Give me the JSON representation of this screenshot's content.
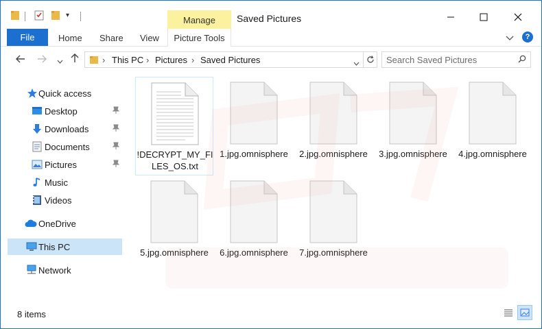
{
  "window": {
    "title": "Saved Pictures",
    "context_group": "Manage",
    "buttons": {
      "minimize": "minimize",
      "maximize": "maximize",
      "close": "close"
    }
  },
  "ribbon": {
    "tabs": [
      {
        "label": "File"
      },
      {
        "label": "Home"
      },
      {
        "label": "Share"
      },
      {
        "label": "View"
      },
      {
        "label": "Picture Tools"
      }
    ]
  },
  "address": {
    "crumbs": [
      "This PC",
      "Pictures",
      "Saved Pictures"
    ]
  },
  "search": {
    "placeholder": "Search Saved Pictures"
  },
  "sidebar": {
    "items": [
      {
        "label": "Quick access",
        "icon": "star-icon"
      },
      {
        "label": "Desktop",
        "icon": "desktop-folder-icon",
        "pinned": true
      },
      {
        "label": "Downloads",
        "icon": "download-arrow-icon",
        "pinned": true
      },
      {
        "label": "Documents",
        "icon": "documents-icon",
        "pinned": true
      },
      {
        "label": "Pictures",
        "icon": "pictures-icon",
        "pinned": true
      },
      {
        "label": "Music",
        "icon": "music-note-icon"
      },
      {
        "label": "Videos",
        "icon": "videos-icon"
      },
      {
        "label": "OneDrive",
        "icon": "cloud-icon"
      },
      {
        "label": "This PC",
        "icon": "computer-icon",
        "selected": true
      },
      {
        "label": "Network",
        "icon": "network-icon"
      }
    ]
  },
  "files": [
    {
      "name_line1": "!DECRYPT_MY_FI",
      "name_line2": "LES_OS.txt",
      "type": "text",
      "selected": true
    },
    {
      "name_line1": "1.jpg.omnisphere",
      "name_line2": "",
      "type": "blank"
    },
    {
      "name_line1": "2.jpg.omnisphere",
      "name_line2": "",
      "type": "blank"
    },
    {
      "name_line1": "3.jpg.omnisphere",
      "name_line2": "",
      "type": "blank"
    },
    {
      "name_line1": "4.jpg.omnisphere",
      "name_line2": "",
      "type": "blank"
    },
    {
      "name_line1": "5.jpg.omnisphere",
      "name_line2": "",
      "type": "blank"
    },
    {
      "name_line1": "6.jpg.omnisphere",
      "name_line2": "",
      "type": "blank"
    },
    {
      "name_line1": "7.jpg.omnisphere",
      "name_line2": "",
      "type": "blank"
    }
  ],
  "status": {
    "count": "8 items"
  },
  "colors": {
    "accent": "#1a6fcf",
    "context": "#fbf19e",
    "selection": "#cce4f7"
  }
}
